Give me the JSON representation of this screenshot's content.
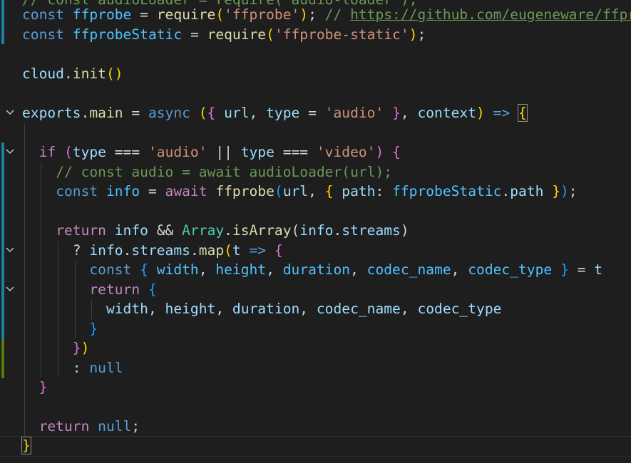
{
  "editor": {
    "language": "javascript",
    "colors": {
      "background": "#1e1e1e",
      "gutter_modified": "#1b81a8",
      "gutter_added": "#587c0c",
      "bracket_level_1": "#ffd700",
      "bracket_level_2": "#da70d6",
      "bracket_level_3": "#179fff"
    },
    "lines": [
      "// const audioLoader = require('audio-loader');",
      "const ffprobe = require('ffprobe'); // https://github.com/eugeneware/ffprobe",
      "const ffprobeStatic = require('ffprobe-static');",
      "",
      "cloud.init()",
      "",
      "exports.main = async ({ url, type = 'audio' }, context) => {",
      "",
      "  if (type === 'audio' || type === 'video') {",
      "    // const audio = await audioLoader(url);",
      "    const info = await ffprobe(url, { path: ffprobeStatic.path });",
      "",
      "    return info && Array.isArray(info.streams)",
      "      ? info.streams.map(t => {",
      "        const { width, height, duration, codec_name, codec_type } = t",
      "        return {",
      "          width, height, duration, codec_name, codec_type",
      "        }",
      "      })",
      "      : null",
      "  }",
      "",
      "  return null;",
      "}"
    ],
    "tokens": {
      "line0": {
        "comment": "// const audioLoader = require('audio-loader');"
      },
      "line1": {
        "kw_const": "const",
        "ident": "ffprobe",
        "op_eq": "=",
        "fn_require": "require",
        "paren_open": "(",
        "str": "'ffprobe'",
        "paren_close": ")",
        "semi": ";",
        "comment": "// ",
        "url": "https://github.com/eugeneware/ffprobe"
      },
      "line2": {
        "kw_const": "const",
        "ident": "ffprobeStatic",
        "op_eq": "=",
        "fn_require": "require",
        "paren_open": "(",
        "str": "'ffprobe-static'",
        "paren_close": ")",
        "semi": ";"
      },
      "line4": {
        "obj": "cloud",
        "dot": ".",
        "fn": "init",
        "paren_open": "(",
        "paren_close": ")"
      },
      "line6": {
        "obj": "exports",
        "dot": ".",
        "fn": "main",
        "op_eq": "=",
        "kw_async": "async",
        "paren_open": "(",
        "brace_open": "{",
        "p_url": "url",
        "comma1": ",",
        "p_type": "type",
        "op_eq2": "=",
        "str": "'audio'",
        "brace_close": "}",
        "comma2": ",",
        "p_context": "context",
        "paren_close": ")",
        "arrow": "=>",
        "body_open": "{"
      },
      "line8": {
        "kw_if": "if",
        "paren_open": "(",
        "v_type1": "type",
        "op_eq3a": "===",
        "str_audio": "'audio'",
        "op_or": "||",
        "v_type2": "type",
        "op_eq3b": "===",
        "str_video": "'video'",
        "paren_close": ")",
        "brace_open": "{"
      },
      "line9": {
        "comment": "// const audio = await audioLoader(url);"
      },
      "line10": {
        "kw_const": "const",
        "ident": "info",
        "op_eq": "=",
        "kw_await": "await",
        "fn": "ffprobe",
        "paren_open": "(",
        "v_url": "url",
        "comma": ",",
        "brace_open": "{",
        "prop": "path",
        "colon": ":",
        "obj": "ffprobeStatic",
        "dot": ".",
        "prop2": "path",
        "brace_close": "}",
        "paren_close": ")",
        "semi": ";"
      },
      "line12": {
        "kw_return": "return",
        "v_info": "info",
        "op_and": "&&",
        "cls": "Array",
        "dot": ".",
        "fn": "isArray",
        "paren_open": "(",
        "v_info2": "info",
        "dot2": ".",
        "prop": "streams",
        "paren_close": ")"
      },
      "line13": {
        "op_q": "?",
        "v_info": "info",
        "dot": ".",
        "prop": "streams",
        "dot2": ".",
        "fn": "map",
        "paren_open": "(",
        "p_t": "t",
        "arrow": "=>",
        "brace_open": "{"
      },
      "line14": {
        "kw_const": "const",
        "brace_open": "{",
        "v_width": "width",
        "c1": ",",
        "v_height": "height",
        "c2": ",",
        "v_duration": "duration",
        "c3": ",",
        "v_codec_name": "codec_name",
        "c4": ",",
        "v_codec_type": "codec_type",
        "brace_close": "}",
        "op_eq": "=",
        "v_t": "t"
      },
      "line15": {
        "kw_return": "return",
        "brace_open": "{"
      },
      "line16": {
        "v_width": "width",
        "c1": ",",
        "v_height": "height",
        "c2": ",",
        "v_duration": "duration",
        "c3": ",",
        "v_codec_name": "codec_name",
        "c4": ",",
        "v_codec_type": "codec_type"
      },
      "line17": {
        "brace_close": "}"
      },
      "line18": {
        "brace_close": "}",
        "paren_close": ")"
      },
      "line19": {
        "op_colon": ":",
        "kw_null": "null"
      },
      "line20": {
        "brace_close": "}"
      },
      "line22": {
        "kw_return": "return",
        "kw_null": "null",
        "semi": ";"
      },
      "line23": {
        "brace_close": "}"
      }
    },
    "fold_icon": "chevron-down-icon",
    "folded_lines": [
      6,
      8,
      12,
      14
    ]
  }
}
